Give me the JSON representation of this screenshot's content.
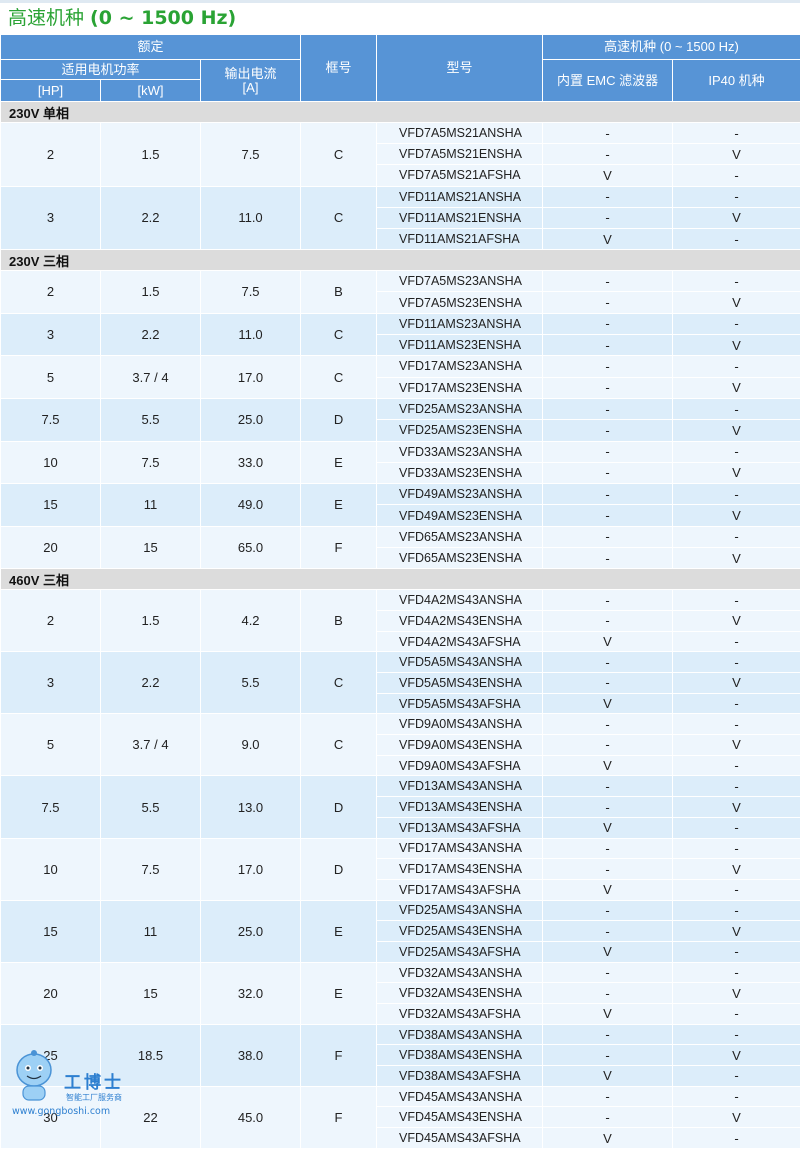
{
  "title": {
    "prefix": "高速机种 ",
    "range": "(0 ~ 1500 Hz)"
  },
  "headers": {
    "rated": "额定",
    "motor_power": "适用电机功率",
    "output_current": "输出电流",
    "unit_hp": "[HP]",
    "unit_kw": "[kW]",
    "unit_a": "[A]",
    "frame": "框号",
    "model": "型号",
    "high_speed": "高速机种 (0 ~ 1500 Hz)",
    "emc": "内置 EMC 滤波器",
    "ip40": "IP40 机种"
  },
  "sections": [
    {
      "label": "230V 单相",
      "groups": [
        {
          "hp": "2",
          "kw": "1.5",
          "a": "7.5",
          "frame": "C",
          "rows": [
            {
              "model": "VFD7A5MS21ANSHA",
              "emc": "-",
              "ip40": "-"
            },
            {
              "model": "VFD7A5MS21ENSHA",
              "emc": "-",
              "ip40": "V"
            },
            {
              "model": "VFD7A5MS21AFSHA",
              "emc": "V",
              "ip40": "-"
            }
          ]
        },
        {
          "hp": "3",
          "kw": "2.2",
          "a": "11.0",
          "frame": "C",
          "rows": [
            {
              "model": "VFD11AMS21ANSHA",
              "emc": "-",
              "ip40": "-"
            },
            {
              "model": "VFD11AMS21ENSHA",
              "emc": "-",
              "ip40": "V"
            },
            {
              "model": "VFD11AMS21AFSHA",
              "emc": "V",
              "ip40": "-"
            }
          ]
        }
      ]
    },
    {
      "label": "230V 三相",
      "groups": [
        {
          "hp": "2",
          "kw": "1.5",
          "a": "7.5",
          "frame": "B",
          "rows": [
            {
              "model": "VFD7A5MS23ANSHA",
              "emc": "-",
              "ip40": "-"
            },
            {
              "model": "VFD7A5MS23ENSHA",
              "emc": "-",
              "ip40": "V"
            }
          ]
        },
        {
          "hp": "3",
          "kw": "2.2",
          "a": "11.0",
          "frame": "C",
          "rows": [
            {
              "model": "VFD11AMS23ANSHA",
              "emc": "-",
              "ip40": "-"
            },
            {
              "model": "VFD11AMS23ENSHA",
              "emc": "-",
              "ip40": "V"
            }
          ]
        },
        {
          "hp": "5",
          "kw": "3.7 / 4",
          "a": "17.0",
          "frame": "C",
          "rows": [
            {
              "model": "VFD17AMS23ANSHA",
              "emc": "-",
              "ip40": "-"
            },
            {
              "model": "VFD17AMS23ENSHA",
              "emc": "-",
              "ip40": "V"
            }
          ]
        },
        {
          "hp": "7.5",
          "kw": "5.5",
          "a": "25.0",
          "frame": "D",
          "rows": [
            {
              "model": "VFD25AMS23ANSHA",
              "emc": "-",
              "ip40": "-"
            },
            {
              "model": "VFD25AMS23ENSHA",
              "emc": "-",
              "ip40": "V"
            }
          ]
        },
        {
          "hp": "10",
          "kw": "7.5",
          "a": "33.0",
          "frame": "E",
          "rows": [
            {
              "model": "VFD33AMS23ANSHA",
              "emc": "-",
              "ip40": "-"
            },
            {
              "model": "VFD33AMS23ENSHA",
              "emc": "-",
              "ip40": "V"
            }
          ]
        },
        {
          "hp": "15",
          "kw": "11",
          "a": "49.0",
          "frame": "E",
          "rows": [
            {
              "model": "VFD49AMS23ANSHA",
              "emc": "-",
              "ip40": "-"
            },
            {
              "model": "VFD49AMS23ENSHA",
              "emc": "-",
              "ip40": "V"
            }
          ]
        },
        {
          "hp": "20",
          "kw": "15",
          "a": "65.0",
          "frame": "F",
          "rows": [
            {
              "model": "VFD65AMS23ANSHA",
              "emc": "-",
              "ip40": "-"
            },
            {
              "model": "VFD65AMS23ENSHA",
              "emc": "-",
              "ip40": "V"
            }
          ]
        }
      ]
    },
    {
      "label": "460V 三相",
      "groups": [
        {
          "hp": "2",
          "kw": "1.5",
          "a": "4.2",
          "frame": "B",
          "rows": [
            {
              "model": "VFD4A2MS43ANSHA",
              "emc": "-",
              "ip40": "-"
            },
            {
              "model": "VFD4A2MS43ENSHA",
              "emc": "-",
              "ip40": "V"
            },
            {
              "model": "VFD4A2MS43AFSHA",
              "emc": "V",
              "ip40": "-"
            }
          ]
        },
        {
          "hp": "3",
          "kw": "2.2",
          "a": "5.5",
          "frame": "C",
          "rows": [
            {
              "model": "VFD5A5MS43ANSHA",
              "emc": "-",
              "ip40": "-"
            },
            {
              "model": "VFD5A5MS43ENSHA",
              "emc": "-",
              "ip40": "V"
            },
            {
              "model": "VFD5A5MS43AFSHA",
              "emc": "V",
              "ip40": "-"
            }
          ]
        },
        {
          "hp": "5",
          "kw": "3.7 / 4",
          "a": "9.0",
          "frame": "C",
          "rows": [
            {
              "model": "VFD9A0MS43ANSHA",
              "emc": "-",
              "ip40": "-"
            },
            {
              "model": "VFD9A0MS43ENSHA",
              "emc": "-",
              "ip40": "V"
            },
            {
              "model": "VFD9A0MS43AFSHA",
              "emc": "V",
              "ip40": "-"
            }
          ]
        },
        {
          "hp": "7.5",
          "kw": "5.5",
          "a": "13.0",
          "frame": "D",
          "rows": [
            {
              "model": "VFD13AMS43ANSHA",
              "emc": "-",
              "ip40": "-"
            },
            {
              "model": "VFD13AMS43ENSHA",
              "emc": "-",
              "ip40": "V"
            },
            {
              "model": "VFD13AMS43AFSHA",
              "emc": "V",
              "ip40": "-"
            }
          ]
        },
        {
          "hp": "10",
          "kw": "7.5",
          "a": "17.0",
          "frame": "D",
          "rows": [
            {
              "model": "VFD17AMS43ANSHA",
              "emc": "-",
              "ip40": "-"
            },
            {
              "model": "VFD17AMS43ENSHA",
              "emc": "-",
              "ip40": "V"
            },
            {
              "model": "VFD17AMS43AFSHA",
              "emc": "V",
              "ip40": "-"
            }
          ]
        },
        {
          "hp": "15",
          "kw": "11",
          "a": "25.0",
          "frame": "E",
          "rows": [
            {
              "model": "VFD25AMS43ANSHA",
              "emc": "-",
              "ip40": "-"
            },
            {
              "model": "VFD25AMS43ENSHA",
              "emc": "-",
              "ip40": "V"
            },
            {
              "model": "VFD25AMS43AFSHA",
              "emc": "V",
              "ip40": "-"
            }
          ]
        },
        {
          "hp": "20",
          "kw": "15",
          "a": "32.0",
          "frame": "E",
          "rows": [
            {
              "model": "VFD32AMS43ANSHA",
              "emc": "-",
              "ip40": "-"
            },
            {
              "model": "VFD32AMS43ENSHA",
              "emc": "-",
              "ip40": "V"
            },
            {
              "model": "VFD32AMS43AFSHA",
              "emc": "V",
              "ip40": "-"
            }
          ]
        },
        {
          "hp": "25",
          "kw": "18.5",
          "a": "38.0",
          "frame": "F",
          "rows": [
            {
              "model": "VFD38AMS43ANSHA",
              "emc": "-",
              "ip40": "-"
            },
            {
              "model": "VFD38AMS43ENSHA",
              "emc": "-",
              "ip40": "V"
            },
            {
              "model": "VFD38AMS43AFSHA",
              "emc": "V",
              "ip40": "-"
            }
          ]
        },
        {
          "hp": "30",
          "kw": "22",
          "a": "45.0",
          "frame": "F",
          "rows": [
            {
              "model": "VFD45AMS43ANSHA",
              "emc": "-",
              "ip40": "-"
            },
            {
              "model": "VFD45AMS43ENSHA",
              "emc": "-",
              "ip40": "V"
            },
            {
              "model": "VFD45AMS43AFSHA",
              "emc": "V",
              "ip40": "-"
            }
          ]
        }
      ]
    }
  ],
  "watermark": {
    "logo": "工博士",
    "sub": "智能工厂服务商",
    "url": "www.gongboshi.com"
  },
  "colors": {
    "title": "#2aa334",
    "header": "#5794d6",
    "row_light": "#eef6fd",
    "row_dark": "#dcedfa",
    "section": "#dcdcdc"
  }
}
